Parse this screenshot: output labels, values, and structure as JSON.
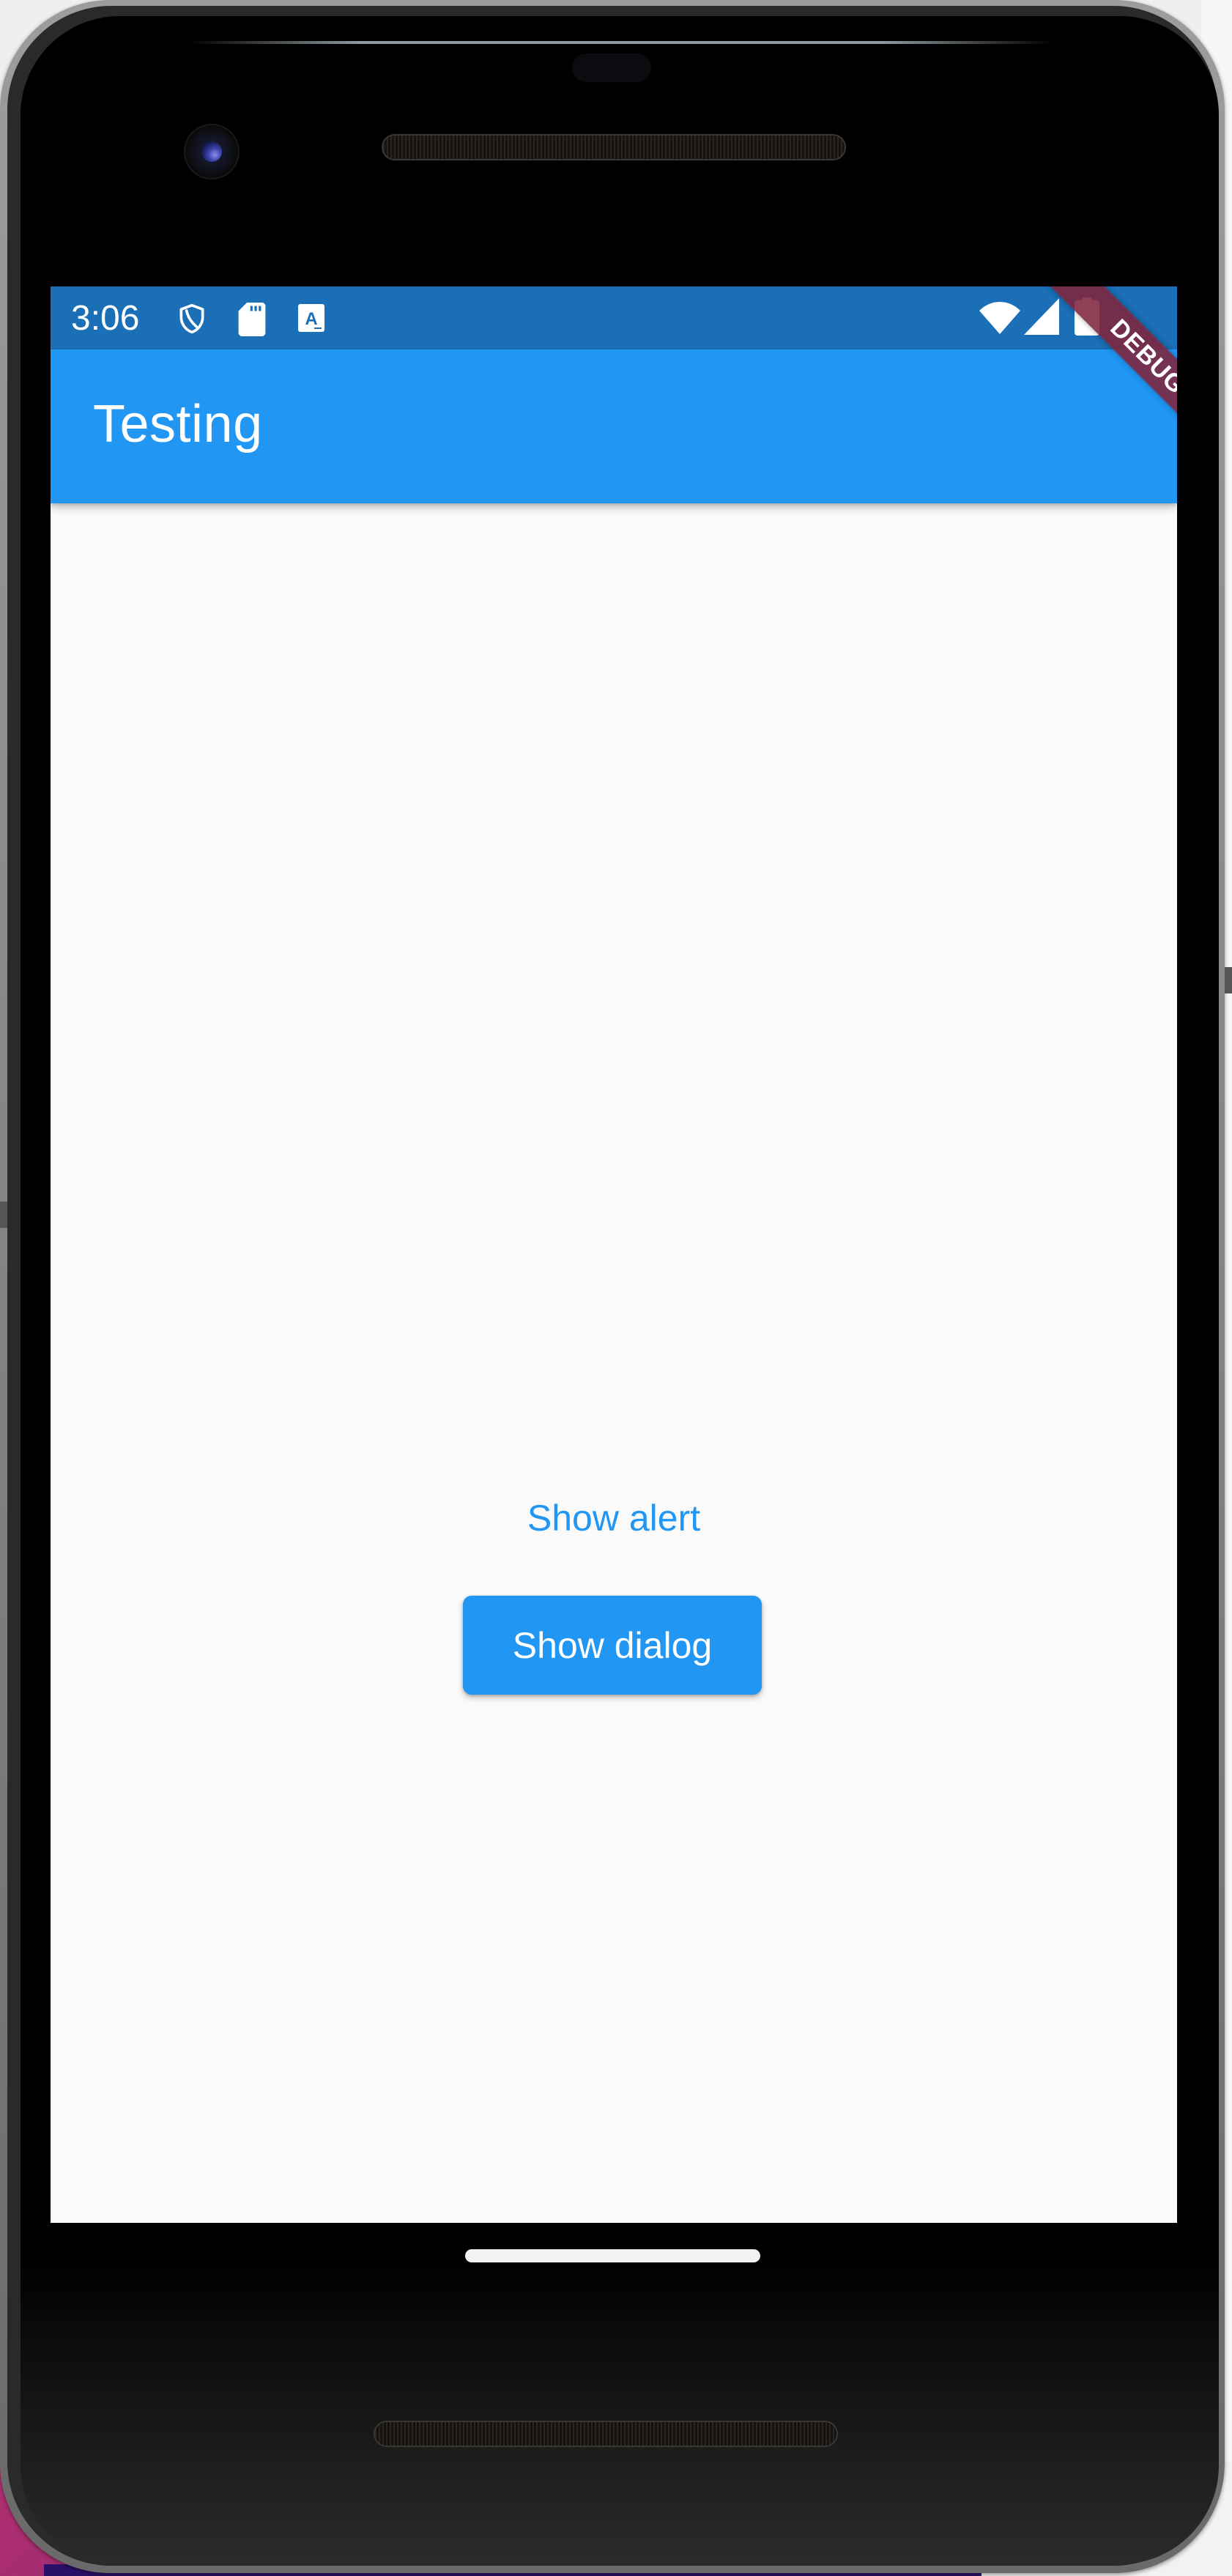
{
  "status_bar": {
    "time": "3:06",
    "left_icons": [
      "shield-icon",
      "sd-card-icon",
      "keyboard-a-icon"
    ],
    "right_icons": [
      "wifi-icon",
      "cell-signal-icon",
      "battery-icon"
    ]
  },
  "app_bar": {
    "title": "Testing"
  },
  "body": {
    "text_button_label": "Show alert",
    "raised_button_label": "Show dialog"
  },
  "debug_banner": {
    "label": "DEBUG"
  },
  "colors": {
    "status_bar": "#1a6fb7",
    "primary": "#2196f3",
    "background": "#fafafa",
    "debug_banner": "#80263c"
  }
}
